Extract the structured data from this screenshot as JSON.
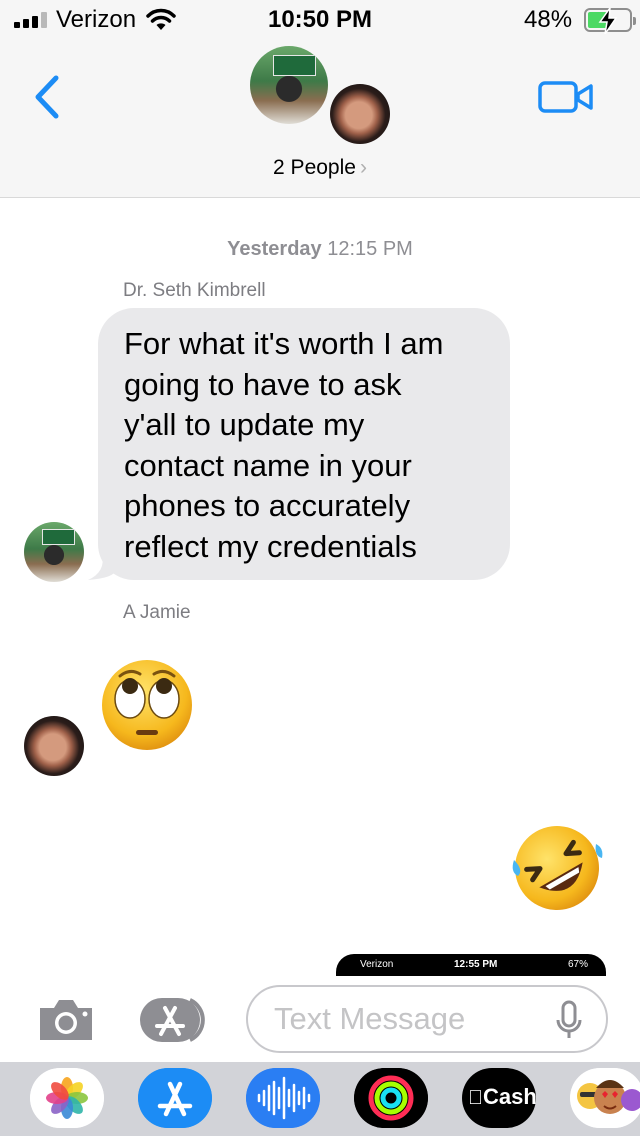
{
  "status_bar": {
    "carrier": "Verizon",
    "time": "10:50 PM",
    "battery_percent": "48%",
    "battery_level": 0.48,
    "charging": true,
    "signal_bars": 3,
    "signal_bars_total": 4
  },
  "header": {
    "people_label": "2 People",
    "chevron": "›"
  },
  "conversation": {
    "timestamp_day": "Yesterday",
    "timestamp_time": "12:15 PM",
    "messages": [
      {
        "sender": "Dr. Seth Kimbrell",
        "lines": [
          "For what it's worth I am",
          "going to have to ask",
          "y'all to update my",
          "contact name in your",
          "phones to accurately",
          "reflect my credentials"
        ]
      },
      {
        "sender": "A Jamie",
        "emoji": "face-with-rolling-eyes"
      },
      {
        "sender": "me",
        "emoji": "rolling-on-the-floor-laughing"
      }
    ],
    "cut_screenshot": {
      "carrier": "Verizon",
      "time": "12:55 PM",
      "battery": "67%"
    }
  },
  "input_bar": {
    "placeholder": "Text Message"
  },
  "app_drawer": {
    "apps": [
      {
        "name": "photos-icon"
      },
      {
        "name": "app-store-icon"
      },
      {
        "name": "audio-message-icon"
      },
      {
        "name": "activity-icon"
      },
      {
        "name": "apple-cash-icon",
        "label": "Cash"
      },
      {
        "name": "memoji-icon"
      }
    ]
  },
  "colors": {
    "ios_blue": "#1c8cf5",
    "bubble_gray": "#e9e9eb",
    "secondary_text": "#8e8e93",
    "battery_green": "#4cd964"
  }
}
